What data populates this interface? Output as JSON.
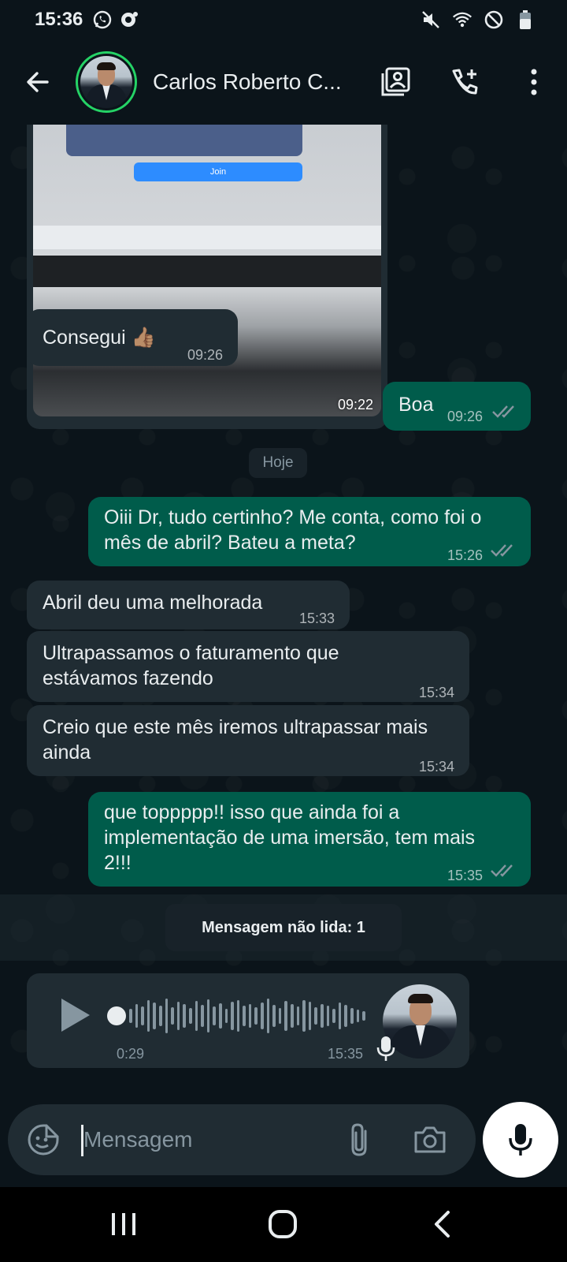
{
  "status_bar": {
    "time": "15:36",
    "left_icons": [
      "whatsapp-icon",
      "notification-icon"
    ],
    "right_icons": [
      "mute-icon",
      "wifi-icon",
      "do-not-disturb-icon",
      "battery-icon"
    ]
  },
  "header": {
    "contact_name": "Carlos Roberto C...",
    "actions": [
      "contact-card-icon",
      "add-call-icon",
      "more-vertical-icon"
    ]
  },
  "messages": [
    {
      "direction": "in",
      "type": "image",
      "time": "09:22",
      "image_texts": {
        "join": "Join"
      }
    },
    {
      "direction": "in",
      "type": "text",
      "text": "Consegui 👍🏽",
      "time": "09:26"
    },
    {
      "direction": "out",
      "type": "text",
      "text": "Boa",
      "time": "09:26",
      "status": "read"
    },
    {
      "direction": "out",
      "type": "text",
      "lines": [
        "Oiii Dr, tudo certinho? Me conta, como foi o",
        "mês de abril? Bateu a meta?"
      ],
      "time": "15:26",
      "status": "read"
    },
    {
      "direction": "in",
      "type": "text",
      "text": "Abril deu uma melhorada",
      "time": "15:33"
    },
    {
      "direction": "in",
      "type": "text",
      "lines": [
        "Ultrapassamos o faturamento que",
        "estávamos fazendo"
      ],
      "time": "15:34"
    },
    {
      "direction": "in",
      "type": "text",
      "lines": [
        "Creio que este mês iremos ultrapassar mais",
        "ainda"
      ],
      "time": "15:34"
    },
    {
      "direction": "out",
      "type": "text",
      "lines": [
        "que toppppp!! isso que ainda foi a",
        "implementação de uma imersão, tem mais",
        "2!!!"
      ],
      "time": "15:35",
      "status": "read"
    }
  ],
  "date_divider": "Hoje",
  "unread_banner": "Mensagem não lida: 1",
  "voice_message": {
    "duration": "0:29",
    "time": "15:35"
  },
  "composer": {
    "placeholder": "Mensagem"
  },
  "colors": {
    "incoming": "#202c33",
    "outgoing": "#005c4b",
    "background": "#0b141a",
    "accent": "#25d366",
    "read_ticks": "#8696a0"
  }
}
